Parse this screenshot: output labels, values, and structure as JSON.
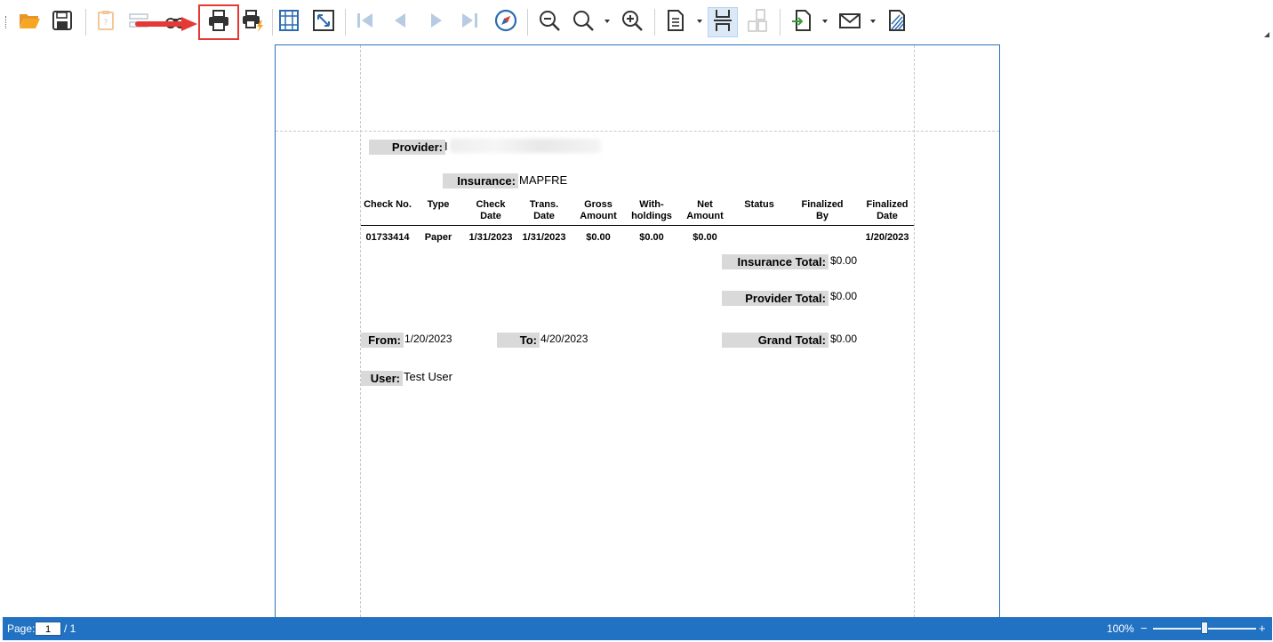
{
  "toolbar": {
    "buttons": [
      {
        "name": "open-icon"
      },
      {
        "name": "save-icon"
      },
      {
        "name": "parameters-icon"
      },
      {
        "name": "edit-parameters-icon"
      },
      {
        "name": "find-icon"
      },
      {
        "name": "print-icon"
      },
      {
        "name": "quick-print-icon"
      },
      {
        "name": "page-setup-icon"
      },
      {
        "name": "scale-icon"
      },
      {
        "name": "first-page-icon"
      },
      {
        "name": "previous-page-icon"
      },
      {
        "name": "next-page-icon"
      },
      {
        "name": "last-page-icon"
      },
      {
        "name": "navigation-icon"
      },
      {
        "name": "zoom-out-icon"
      },
      {
        "name": "zoom-icon"
      },
      {
        "name": "zoom-in-icon"
      },
      {
        "name": "single-page-icon"
      },
      {
        "name": "continuous-view-icon"
      },
      {
        "name": "multiple-pages-icon"
      },
      {
        "name": "export-icon"
      },
      {
        "name": "email-icon"
      },
      {
        "name": "watermark-icon"
      }
    ],
    "colors": {
      "accent": "#2272c3",
      "highlight": "#e53935",
      "folder": "#f5a623"
    }
  },
  "report": {
    "provider_label": "Provider:",
    "provider_value": "I",
    "insurance_label": "Insurance:",
    "insurance_value": "MAPFRE",
    "columns": [
      {
        "l1": "",
        "l2": "Check No."
      },
      {
        "l1": "",
        "l2": "Type"
      },
      {
        "l1": "Check",
        "l2": "Date"
      },
      {
        "l1": "Trans.",
        "l2": "Date"
      },
      {
        "l1": "Gross",
        "l2": "Amount"
      },
      {
        "l1": "With-",
        "l2": "holdings"
      },
      {
        "l1": "Net",
        "l2": "Amount"
      },
      {
        "l1": "",
        "l2": "Status"
      },
      {
        "l1": "Finalized",
        "l2": "By"
      },
      {
        "l1": "Finalized",
        "l2": "Date"
      }
    ],
    "rows": [
      [
        "01733414",
        "Paper",
        "1/31/2023",
        "1/31/2023",
        "$0.00",
        "$0.00",
        "$0.00",
        "",
        "",
        "1/20/2023"
      ]
    ],
    "insurance_total_label": "Insurance Total:",
    "insurance_total_value": "$0.00",
    "provider_total_label": "Provider Total:",
    "provider_total_value": "$0.00",
    "from_label": "From:",
    "from_value": "1/20/2023",
    "to_label": "To:",
    "to_value": "4/20/2023",
    "grand_total_label": "Grand Total:",
    "grand_total_value": "$0.00",
    "user_label": "User:",
    "user_value": "Test User"
  },
  "statusbar": {
    "page_label": "Page:",
    "page_current": "1",
    "page_total": "/ 1",
    "zoom": "100%",
    "zoom_minus": "−",
    "zoom_plus": "+",
    "zoom_level": 0.5
  }
}
